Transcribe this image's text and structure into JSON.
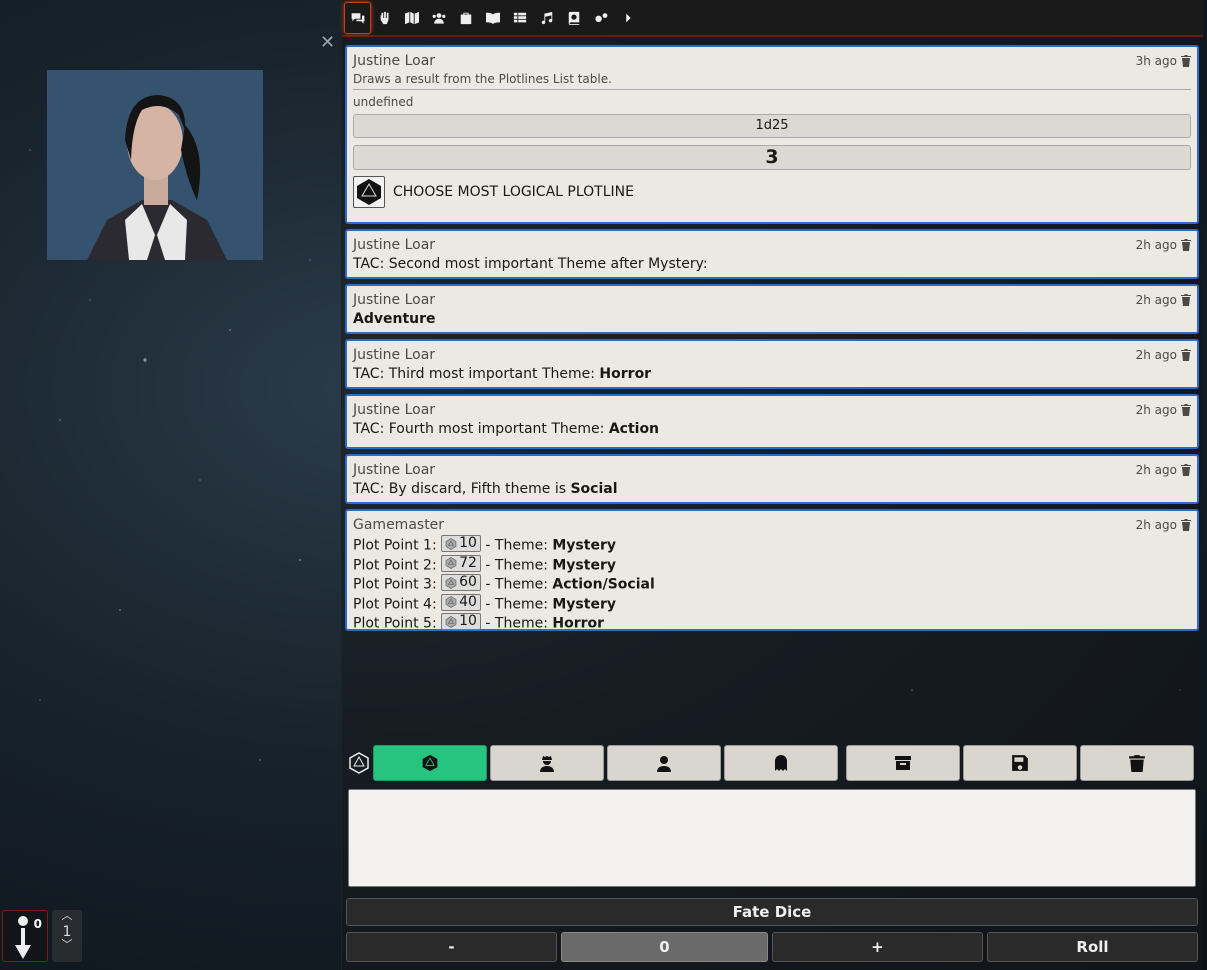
{
  "tabs": [
    {
      "name": "chat",
      "icon": "comments-icon"
    },
    {
      "name": "combat",
      "icon": "fist-raised-icon"
    },
    {
      "name": "scenes",
      "icon": "map-icon"
    },
    {
      "name": "actors",
      "icon": "users-icon"
    },
    {
      "name": "items",
      "icon": "suitcase-icon"
    },
    {
      "name": "journal",
      "icon": "book-open-icon"
    },
    {
      "name": "tables",
      "icon": "th-list-icon"
    },
    {
      "name": "playlists",
      "icon": "music-icon"
    },
    {
      "name": "compendium",
      "icon": "atlas-icon"
    },
    {
      "name": "settings",
      "icon": "cogs-icon"
    },
    {
      "name": "collapse",
      "icon": "caret-right-icon"
    }
  ],
  "messages": [
    {
      "speaker": "Justine Loar",
      "time": "3h ago",
      "flavor": "Draws a result from the Plotlines List table.",
      "undefined": "undefined",
      "formula": "1d25",
      "total": "3",
      "result_text": "CHOOSE MOST LOGICAL PLOTLINE"
    },
    {
      "speaker": "Justine Loar",
      "time": "2h ago",
      "text": "TAC: Second most important Theme after Mystery:"
    },
    {
      "speaker": "Justine Loar",
      "time": "2h ago",
      "bold": "Adventure"
    },
    {
      "speaker": "Justine Loar",
      "time": "2h ago",
      "text": "TAC: Third most important Theme: ",
      "bold": "Horror"
    },
    {
      "speaker": "Justine Loar",
      "time": "2h ago",
      "text": "TAC: Fourth most important Theme: ",
      "bold": "Action"
    },
    {
      "speaker": "Justine Loar",
      "time": "2h ago",
      "text": "TAC: By discard, Fifth theme is ",
      "bold": "Social"
    },
    {
      "speaker": "Gamemaster",
      "time": "2h ago",
      "plot_points": [
        {
          "label": "Plot Point 1: ",
          "roll": "10",
          "sep": " - Theme: ",
          "theme": "Mystery"
        },
        {
          "label": "Plot Point 2: ",
          "roll": "72",
          "sep": " - Theme: ",
          "theme": "Mystery"
        },
        {
          "label": "Plot Point 3: ",
          "roll": "60",
          "sep": " - Theme: ",
          "theme": "Action/Social"
        },
        {
          "label": "Plot Point 4: ",
          "roll": "40",
          "sep": " - Theme: ",
          "theme": "Mystery"
        },
        {
          "label": "Plot Point 5: ",
          "roll": "10",
          "sep": " - Theme: ",
          "theme": "Horror"
        }
      ]
    }
  ],
  "roll_types": [
    {
      "name": "public-roll",
      "icon": "dice-d20-icon",
      "active": true
    },
    {
      "name": "gm-roll",
      "icon": "user-secret-icon",
      "active": false
    },
    {
      "name": "self-roll",
      "icon": "user-ninja-icon",
      "active": false
    },
    {
      "name": "blind-roll",
      "icon": "ghost-icon",
      "active": false
    }
  ],
  "chat_controls": [
    {
      "name": "export-button",
      "icon": "archive-icon"
    },
    {
      "name": "save-button",
      "icon": "save-icon"
    },
    {
      "name": "clear-chat-button",
      "icon": "trash-icon"
    }
  ],
  "fate": {
    "title": "Fate Dice",
    "minus": "-",
    "value": "0",
    "plus": "+",
    "roll": "Roll"
  },
  "fate_widget": {
    "count": "0"
  },
  "turn_widget": {
    "value": "1"
  },
  "colors": {
    "accent": "#2d6bc4",
    "active_roll": "#27c47f",
    "tab_border": "#c04020"
  }
}
